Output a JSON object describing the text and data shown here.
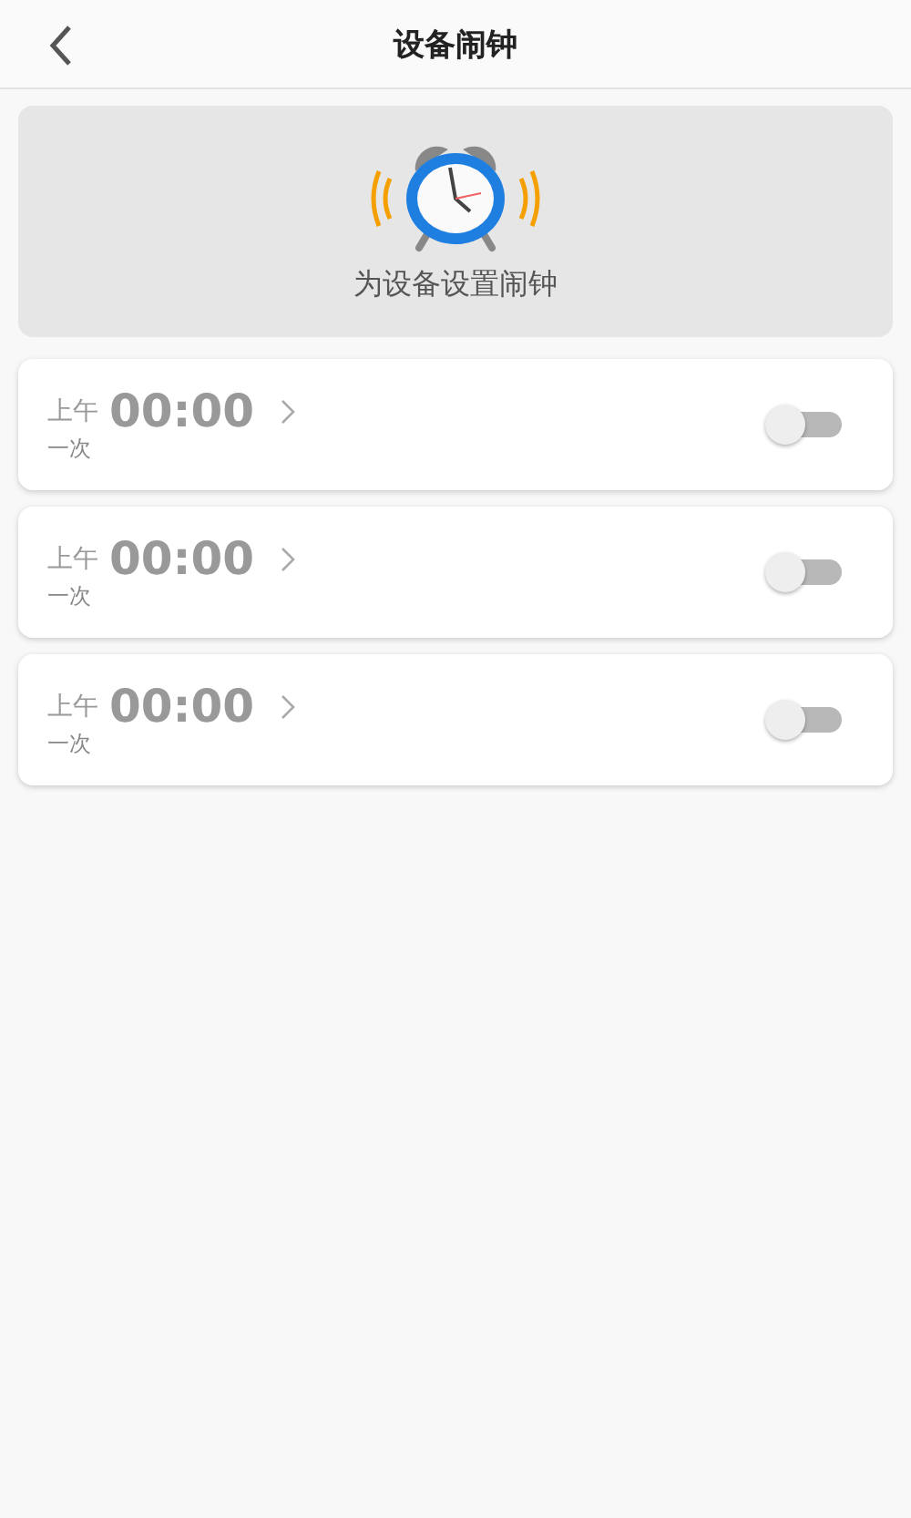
{
  "header": {
    "title": "设备闹钟"
  },
  "banner": {
    "caption": "为设备设置闹钟"
  },
  "alarms": [
    {
      "period": "上午",
      "time": "00:00",
      "repeat": "一次",
      "on": false
    },
    {
      "period": "上午",
      "time": "00:00",
      "repeat": "一次",
      "on": false
    },
    {
      "period": "上午",
      "time": "00:00",
      "repeat": "一次",
      "on": false
    }
  ]
}
